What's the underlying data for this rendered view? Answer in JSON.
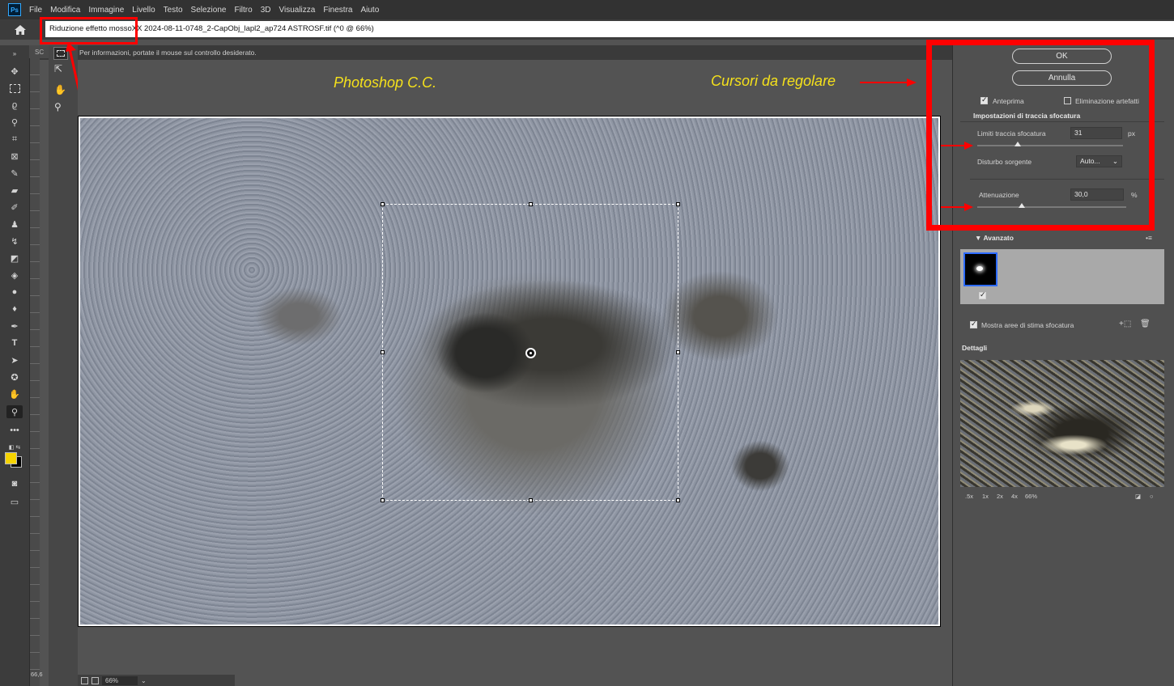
{
  "menubar": {
    "app_logo": "Ps",
    "items": [
      "File",
      "Modifica",
      "Immagine",
      "Livello",
      "Testo",
      "Selezione",
      "Filtro",
      "3D",
      "Visualizza",
      "Finestra",
      "Aiuto"
    ]
  },
  "titlebar": {
    "dialog_title": "Riduzione effetto mosso",
    "document": "XX 2024-08-11-0748_2-CapObj_lapl2_ap724 ASTROSF.tif (^0 @ 66%)"
  },
  "optionsbar": {
    "info_text": "Per informazioni, portate il mouse sul controllo desiderato.",
    "tab_stub": "SC"
  },
  "annotations": {
    "note_left": "Photoshop C.C.",
    "note_right": "Cursori da regolare"
  },
  "statusbar": {
    "zoom": "66%",
    "side_zoom": "66,6"
  },
  "panel": {
    "ok_label": "OK",
    "cancel_label": "Annulla",
    "preview_label": "Anteprima",
    "artifact_label": "Eliminazione artefatti",
    "section_trace": "Impostazioni di traccia sfocatura",
    "trace_limit_label": "Limiti traccia sfocatura",
    "trace_limit_value": "31",
    "trace_limit_unit": "px",
    "trace_limit_fraction": 0.28,
    "noise_label": "Disturbo sorgente",
    "noise_value": "Auto...",
    "attenuation_label": "Attenuazione",
    "attenuation_value": "30,0",
    "attenuation_unit": "%",
    "attenuation_fraction": 0.3,
    "advanced_label": "Avanzato",
    "show_areas_label": "Mostra aree di stima sfocatura",
    "details_label": "Dettagli",
    "detail_zooms": [
      ".5x",
      "1x",
      "2x",
      "4x",
      "66%"
    ]
  },
  "colors": {
    "annotation_red": "#ff0000",
    "annotation_yellow": "#f5e11b",
    "foreground_swatch": "#f6d400",
    "background_swatch": "#000000"
  }
}
